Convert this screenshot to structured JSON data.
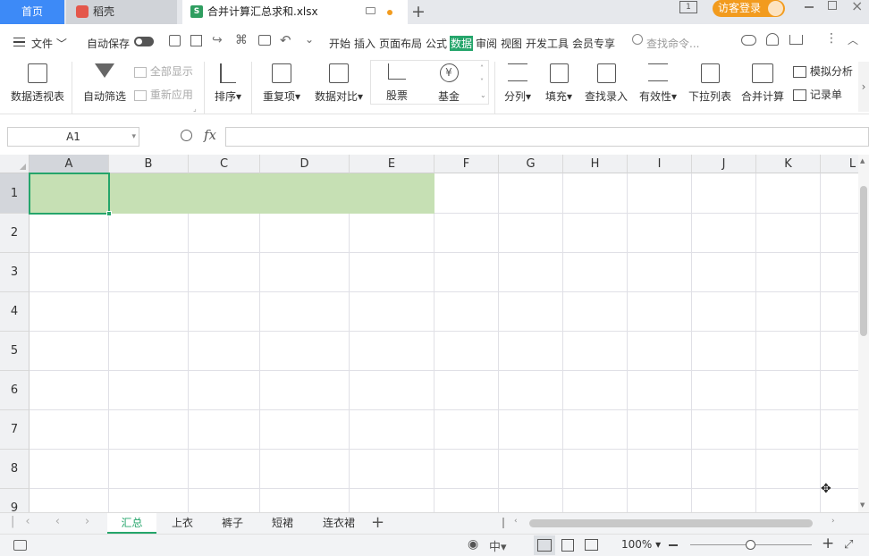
{
  "tabs": {
    "home": "首页",
    "daoke": "稻壳",
    "file": "合并计算汇总求和.xlsx",
    "file_icon": "S",
    "login": "访客登录",
    "colors": {
      "home_bg": "#3d8af7",
      "login_bg": "#f29b1e",
      "active_menu": "#25a56b"
    }
  },
  "menubar": {
    "file": "文件",
    "autosave": "自动保存",
    "items": [
      "开始",
      "插入",
      "页面布局",
      "公式",
      "数据",
      "审阅",
      "视图",
      "开发工具",
      "会员专享"
    ],
    "active": "数据",
    "search_placeholder": "查找命令..."
  },
  "ribbon": {
    "pivot": "数据透视表",
    "autofilter": "自动筛选",
    "show_all": "全部显示",
    "reapply": "重新应用",
    "sort": "排序",
    "duplicates": "重复项",
    "compare": "数据对比",
    "stock": "股票",
    "fund": "基金",
    "split": "分列",
    "fill": "填充",
    "lookup": "查找录入",
    "validity": "有效性",
    "dropdown": "下拉列表",
    "consolidate": "合并计算",
    "whatif": "模拟分析",
    "record": "记录单"
  },
  "formula": {
    "cell_ref": "A1",
    "fx": "fx",
    "value": ""
  },
  "grid": {
    "columns": [
      "A",
      "B",
      "C",
      "D",
      "E",
      "F",
      "G",
      "H",
      "I",
      "J",
      "K",
      "L"
    ],
    "rows": [
      "1",
      "2",
      "3",
      "4",
      "5",
      "6",
      "7",
      "8",
      "9"
    ],
    "selection_color": "#c6e0b4"
  },
  "sheets": {
    "names": [
      "汇总",
      "上衣",
      "裤子",
      "短裙",
      "连衣裙"
    ],
    "active": "汇总",
    "active_color": "#25a56b"
  },
  "status": {
    "zoom": "100%",
    "zoom_level": 0.5
  }
}
